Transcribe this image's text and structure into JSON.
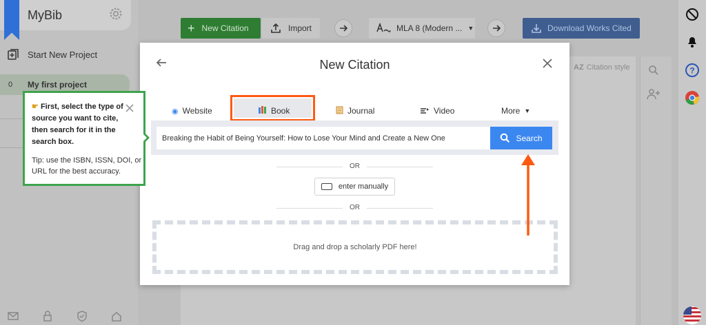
{
  "app": {
    "name": "MyBib"
  },
  "sidebar": {
    "new_project": "Start New Project",
    "project": {
      "count": "0",
      "name": "My first project"
    }
  },
  "toolbar": {
    "new_citation": "New Citation",
    "import": "Import",
    "style": "MLA 8 (Modern ...",
    "download": "Download Works Cited",
    "citation_style": "Citation style"
  },
  "modal": {
    "title": "New Citation",
    "tabs": [
      "Website",
      "Book",
      "Journal",
      "Video",
      "More"
    ],
    "active_tab": "Book",
    "search_value": "Breaking the Habit of Being Yourself: How to Lose Your Mind and Create a New One",
    "search_button": "Search",
    "or": "OR",
    "manual": "enter manually",
    "dropzone": "Drag and drop a scholarly PDF here!"
  },
  "tooltip": {
    "main": "First, select the type of source you want to cite, then search for it in the search box.",
    "hint": "Tip: use the ISBN, ISSN, DOI, or URL for the best accuracy."
  },
  "colors": {
    "highlight": "#ff5a12",
    "tooltip_border": "#3fa34d",
    "search_button": "#3b87f0",
    "new_citation": "#2e7d32",
    "download": "#3f5d8f"
  }
}
